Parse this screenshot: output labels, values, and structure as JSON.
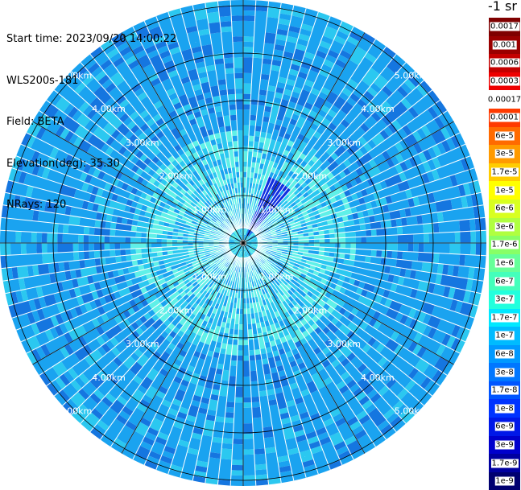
{
  "info": {
    "start_time": "Start time: 2023/09/20 14:00:22",
    "device": "WLS200s-181",
    "field": "Field: BETA",
    "elevation": "Elevation(deg): 35.30",
    "nrays": "NRays: 120"
  },
  "colorbar": {
    "unit_label": "-1 sr",
    "items": [
      {
        "label": "0.0017",
        "color": "#7f0000"
      },
      {
        "label": "0.001",
        "color": "#9a0000"
      },
      {
        "label": "0.0006",
        "color": "#c40000"
      },
      {
        "label": "0.0003",
        "color": "#ee0000"
      },
      {
        "label": "0.00017",
        "color": "#ffffff"
      },
      {
        "label": "0.0001",
        "color": "#ff3a00"
      },
      {
        "label": "6e-5",
        "color": "#ff6a00"
      },
      {
        "label": "3e-5",
        "color": "#ff9a00"
      },
      {
        "label": "1.7e-5",
        "color": "#ffcc00"
      },
      {
        "label": "1e-5",
        "color": "#ffff00"
      },
      {
        "label": "6e-6",
        "color": "#d8ff20"
      },
      {
        "label": "3e-6",
        "color": "#b0ff40"
      },
      {
        "label": "1.7e-6",
        "color": "#88ff66"
      },
      {
        "label": "1e-6",
        "color": "#66ff99"
      },
      {
        "label": "6e-7",
        "color": "#44ffbb"
      },
      {
        "label": "3e-7",
        "color": "#22ffdd"
      },
      {
        "label": "1.7e-7",
        "color": "#00e8ff"
      },
      {
        "label": "1e-7",
        "color": "#00bbff"
      },
      {
        "label": "6e-8",
        "color": "#0099ff"
      },
      {
        "label": "3e-8",
        "color": "#0077ff"
      },
      {
        "label": "1.7e-8",
        "color": "#0055ff"
      },
      {
        "label": "1e-8",
        "color": "#0033ff"
      },
      {
        "label": "6e-9",
        "color": "#0018e8"
      },
      {
        "label": "3e-9",
        "color": "#0000cc"
      },
      {
        "label": "1.7e-9",
        "color": "#0000a0"
      },
      {
        "label": "1e-9",
        "color": "#000070"
      }
    ]
  },
  "range_labels": [
    "1.00km",
    "2.00km",
    "3.00km",
    "4.00km",
    "5.00km"
  ],
  "colors": {
    "base": "#1aa3f0",
    "light": "#2bc8f0",
    "dark": "#1576e0",
    "cyan": "#5ff0e8",
    "ring": "#000000",
    "gap": "#ffffff"
  }
}
